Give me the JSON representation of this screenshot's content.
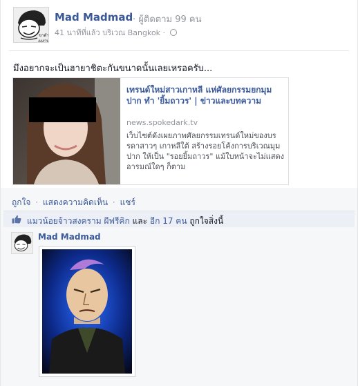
{
  "post": {
    "author": "Mad Madmad",
    "follow_text": "· ผู้ติดตาม 99 คน",
    "meta": "41 นาทีที่แล้ว บริเวณ Bangkok ·",
    "avatar_caption": "ขาดำ\nงงงาน",
    "message": "มึงอยากจะเป็นฮายาชิตะกันขนาดนั้นเลยเหรอครับ..."
  },
  "link": {
    "title": "เทรนด์ใหม่สาวเกาหลี แห่ศัลยกรรมยกมุมปาก ทำ 'ยิ้มถาวร' | ข่าวและบทความ",
    "domain": "news.spokedark.tv",
    "description": "เว็บไซต์ดังเผยภาพศัลยกรรมเทรนด์ใหม่ของบรรดาสาวๆ เกาหลีใต้ สร้างรอยโค้งการบริเวณมุมปาก ให้เป็น \"รอยยิ้มถาวร\" แม้ใบหน้าจะไม่แสดงอารมณ์ใดๆ ก็ตาม"
  },
  "actions": {
    "like": "ถูกใจ",
    "comment": "แสดงความคิดเห็น",
    "share": "แชร์",
    "sep": "·"
  },
  "likes": {
    "names": "แมวน้อยจ้าวสงคราม ผีฟรีคิก",
    "and": "และ",
    "others": "อีก 17 คน",
    "suffix": "ถูกใจสิ่งนี้"
  },
  "comment": {
    "author": "Mad Madmad"
  },
  "colors": {
    "link_blue": "#3b5998",
    "meta_gray": "#90949c",
    "ufi_bg": "#f6f7f9",
    "likes_bg": "#eceff5"
  }
}
